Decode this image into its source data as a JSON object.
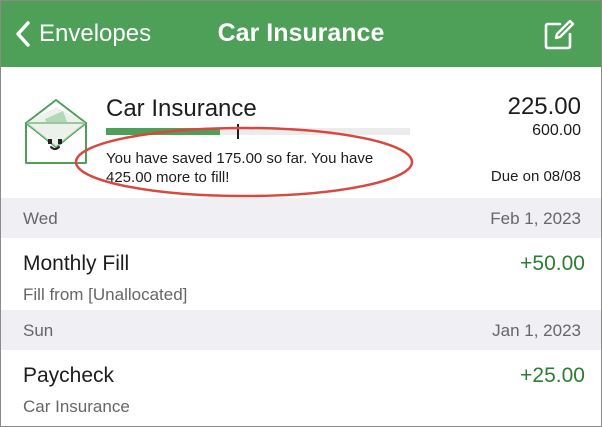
{
  "nav": {
    "back_label": "Envelopes",
    "title": "Car Insurance",
    "bar_color": "#4e9f58"
  },
  "envelope": {
    "name": "Car Insurance",
    "amount": "225.00",
    "goal": "600.00",
    "saved_message": "You have saved 175.00 so far. You have 425.00 more to fill!",
    "due": "Due on 08/08",
    "progress_fraction": 0.375,
    "target_fraction": 0.43
  },
  "sections": [
    {
      "day": "Wed",
      "date": "Feb 1, 2023",
      "transactions": [
        {
          "title": "Monthly Fill",
          "subtitle": "Fill from [Unallocated]",
          "amount": "+50.00"
        }
      ]
    },
    {
      "day": "Sun",
      "date": "Jan 1, 2023",
      "transactions": [
        {
          "title": "Paycheck",
          "subtitle": "Car Insurance",
          "amount": "+25.00"
        }
      ]
    }
  ],
  "icons": {
    "back": "chevron-left-icon",
    "edit": "compose-icon",
    "envelope": "envelope-face-icon"
  },
  "colors": {
    "positive_amount": "#2e7d32",
    "annotation": "#d9473f"
  }
}
